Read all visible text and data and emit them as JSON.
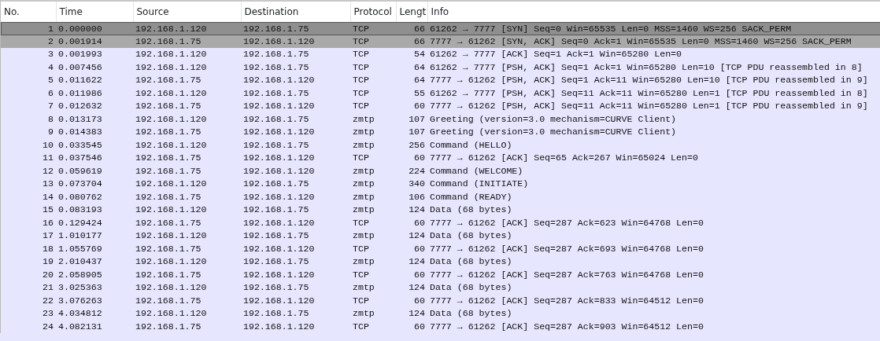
{
  "columns": [
    "No.",
    "Time",
    "Source",
    "Destination",
    "Protocol",
    "Lengt",
    "Info"
  ],
  "rows": [
    {
      "no": "1",
      "time": "0.000000",
      "source": "192.168.1.120",
      "destination": "192.168.1.75",
      "protocol": "TCP",
      "length": "66",
      "info": "61262 → 7777 [SYN] Seq=0 Win=65535 Len=0 MSS=1460 WS=256 SACK_PERM",
      "selected": true,
      "related": false
    },
    {
      "no": "2",
      "time": "0.001914",
      "source": "192.168.1.75",
      "destination": "192.168.1.120",
      "protocol": "TCP",
      "length": "66",
      "info": "7777 → 61262 [SYN, ACK] Seq=0 Ack=1 Win=65535 Len=0 MSS=1460 WS=256 SACK_PERM",
      "selected": false,
      "related": true
    },
    {
      "no": "3",
      "time": "0.001993",
      "source": "192.168.1.120",
      "destination": "192.168.1.75",
      "protocol": "TCP",
      "length": "54",
      "info": "61262 → 7777 [ACK] Seq=1 Ack=1 Win=65280 Len=0",
      "selected": false,
      "related": false
    },
    {
      "no": "4",
      "time": "0.007456",
      "source": "192.168.1.120",
      "destination": "192.168.1.75",
      "protocol": "TCP",
      "length": "64",
      "info": "61262 → 7777 [PSH, ACK] Seq=1 Ack=1 Win=65280 Len=10 [TCP PDU reassembled in 8]",
      "selected": false,
      "related": false
    },
    {
      "no": "5",
      "time": "0.011622",
      "source": "192.168.1.75",
      "destination": "192.168.1.120",
      "protocol": "TCP",
      "length": "64",
      "info": "7777 → 61262 [PSH, ACK] Seq=1 Ack=11 Win=65280 Len=10 [TCP PDU reassembled in 9]",
      "selected": false,
      "related": false
    },
    {
      "no": "6",
      "time": "0.011986",
      "source": "192.168.1.120",
      "destination": "192.168.1.75",
      "protocol": "TCP",
      "length": "55",
      "info": "61262 → 7777 [PSH, ACK] Seq=11 Ack=11 Win=65280 Len=1 [TCP PDU reassembled in 8]",
      "selected": false,
      "related": false
    },
    {
      "no": "7",
      "time": "0.012632",
      "source": "192.168.1.75",
      "destination": "192.168.1.120",
      "protocol": "TCP",
      "length": "60",
      "info": "7777 → 61262 [PSH, ACK] Seq=11 Ack=11 Win=65280 Len=1 [TCP PDU reassembled in 9]",
      "selected": false,
      "related": false
    },
    {
      "no": "8",
      "time": "0.013173",
      "source": "192.168.1.120",
      "destination": "192.168.1.75",
      "protocol": "zmtp",
      "length": "107",
      "info": "Greeting (version=3.0 mechanism=CURVE Client)",
      "selected": false,
      "related": false
    },
    {
      "no": "9",
      "time": "0.014383",
      "source": "192.168.1.75",
      "destination": "192.168.1.120",
      "protocol": "zmtp",
      "length": "107",
      "info": "Greeting (version=3.0 mechanism=CURVE Client)",
      "selected": false,
      "related": false
    },
    {
      "no": "10",
      "time": "0.033545",
      "source": "192.168.1.120",
      "destination": "192.168.1.75",
      "protocol": "zmtp",
      "length": "256",
      "info": "Command (HELLO)",
      "selected": false,
      "related": false
    },
    {
      "no": "11",
      "time": "0.037546",
      "source": "192.168.1.75",
      "destination": "192.168.1.120",
      "protocol": "TCP",
      "length": "60",
      "info": "7777 → 61262 [ACK] Seq=65 Ack=267 Win=65024 Len=0",
      "selected": false,
      "related": false
    },
    {
      "no": "12",
      "time": "0.059619",
      "source": "192.168.1.75",
      "destination": "192.168.1.120",
      "protocol": "zmtp",
      "length": "224",
      "info": "Command (WELCOME)",
      "selected": false,
      "related": false
    },
    {
      "no": "13",
      "time": "0.073704",
      "source": "192.168.1.120",
      "destination": "192.168.1.75",
      "protocol": "zmtp",
      "length": "340",
      "info": "Command (INITIATE)",
      "selected": false,
      "related": false
    },
    {
      "no": "14",
      "time": "0.080762",
      "source": "192.168.1.75",
      "destination": "192.168.1.120",
      "protocol": "zmtp",
      "length": "106",
      "info": "Command (READY)",
      "selected": false,
      "related": false
    },
    {
      "no": "15",
      "time": "0.083193",
      "source": "192.168.1.120",
      "destination": "192.168.1.75",
      "protocol": "zmtp",
      "length": "124",
      "info": "Data (68 bytes)",
      "selected": false,
      "related": false
    },
    {
      "no": "16",
      "time": "0.129424",
      "source": "192.168.1.75",
      "destination": "192.168.1.120",
      "protocol": "TCP",
      "length": "60",
      "info": "7777 → 61262 [ACK] Seq=287 Ack=623 Win=64768 Len=0",
      "selected": false,
      "related": false
    },
    {
      "no": "17",
      "time": "1.010177",
      "source": "192.168.1.120",
      "destination": "192.168.1.75",
      "protocol": "zmtp",
      "length": "124",
      "info": "Data (68 bytes)",
      "selected": false,
      "related": false
    },
    {
      "no": "18",
      "time": "1.055769",
      "source": "192.168.1.75",
      "destination": "192.168.1.120",
      "protocol": "TCP",
      "length": "60",
      "info": "7777 → 61262 [ACK] Seq=287 Ack=693 Win=64768 Len=0",
      "selected": false,
      "related": false
    },
    {
      "no": "19",
      "time": "2.010437",
      "source": "192.168.1.120",
      "destination": "192.168.1.75",
      "protocol": "zmtp",
      "length": "124",
      "info": "Data (68 bytes)",
      "selected": false,
      "related": false
    },
    {
      "no": "20",
      "time": "2.058905",
      "source": "192.168.1.75",
      "destination": "192.168.1.120",
      "protocol": "TCP",
      "length": "60",
      "info": "7777 → 61262 [ACK] Seq=287 Ack=763 Win=64768 Len=0",
      "selected": false,
      "related": false
    },
    {
      "no": "21",
      "time": "3.025363",
      "source": "192.168.1.120",
      "destination": "192.168.1.75",
      "protocol": "zmtp",
      "length": "124",
      "info": "Data (68 bytes)",
      "selected": false,
      "related": false
    },
    {
      "no": "22",
      "time": "3.076263",
      "source": "192.168.1.75",
      "destination": "192.168.1.120",
      "protocol": "TCP",
      "length": "60",
      "info": "7777 → 61262 [ACK] Seq=287 Ack=833 Win=64512 Len=0",
      "selected": false,
      "related": false
    },
    {
      "no": "23",
      "time": "4.034812",
      "source": "192.168.1.120",
      "destination": "192.168.1.75",
      "protocol": "zmtp",
      "length": "124",
      "info": "Data (68 bytes)",
      "selected": false,
      "related": false
    },
    {
      "no": "24",
      "time": "4.082131",
      "source": "192.168.1.75",
      "destination": "192.168.1.120",
      "protocol": "TCP",
      "length": "60",
      "info": "7777 → 61262 [ACK] Seq=287 Ack=903 Win=64512 Len=0",
      "selected": false,
      "related": false
    }
  ]
}
